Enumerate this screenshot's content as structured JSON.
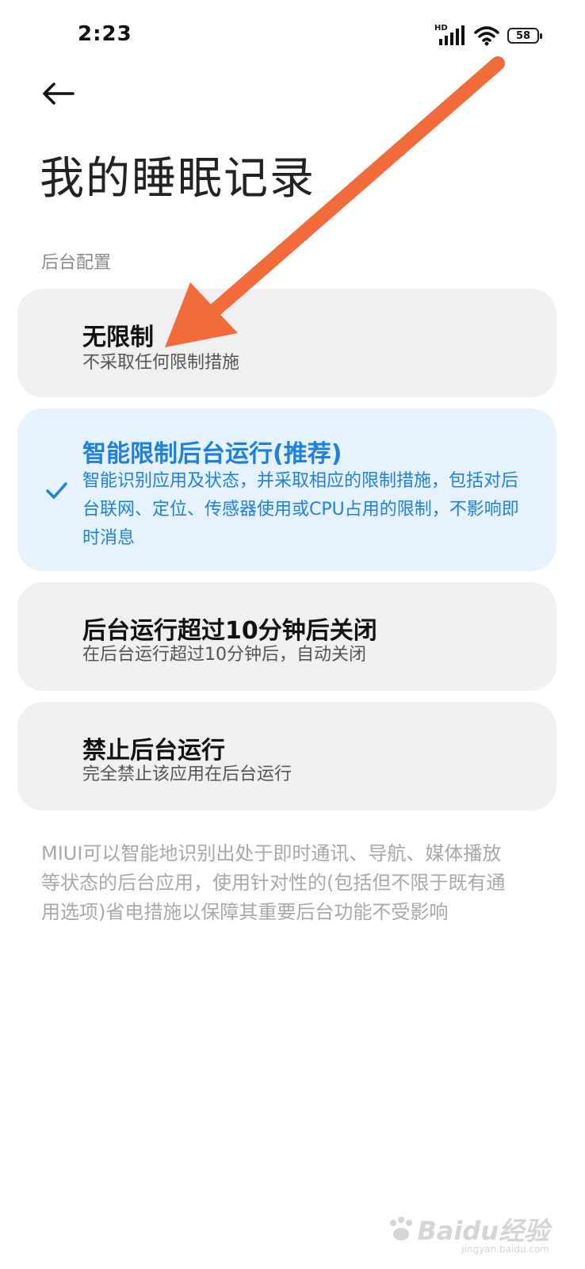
{
  "status_bar": {
    "time": "2:23",
    "network_label": "HD",
    "battery": "58"
  },
  "header": {
    "back_icon": "arrow-left-icon",
    "title": "我的睡眠记录"
  },
  "section": {
    "label": "后台配置"
  },
  "options": [
    {
      "title": "无限制",
      "desc": "不采取任何限制措施",
      "selected": false
    },
    {
      "title": "智能限制后台运行(推荐)",
      "desc": "智能识别应用及状态，并采取相应的限制措施，包括对后台联网、定位、传感器使用或CPU占用的限制，不影响即时消息",
      "selected": true
    },
    {
      "title": "后台运行超过10分钟后关闭",
      "desc": "在后台运行超过10分钟后，自动关闭",
      "selected": false
    },
    {
      "title": "禁止后台运行",
      "desc": "完全禁止该应用在后台运行",
      "selected": false
    }
  ],
  "footer_note": "MIUI可以智能地识别出处于即时通讯、导航、媒体播放等状态的后台应用，使用针对性的(包括但不限于既有通用选项)省电措施以保障其重要后台功能不受影响",
  "watermark": {
    "text": "Baidu经验",
    "sub": "jingyan.baidu.com"
  },
  "colors": {
    "accent": "#1f7fdc",
    "selected_bg": "#e6f2fd",
    "card_bg": "#f0f0f0",
    "annotation_arrow": "#f26b3a"
  }
}
